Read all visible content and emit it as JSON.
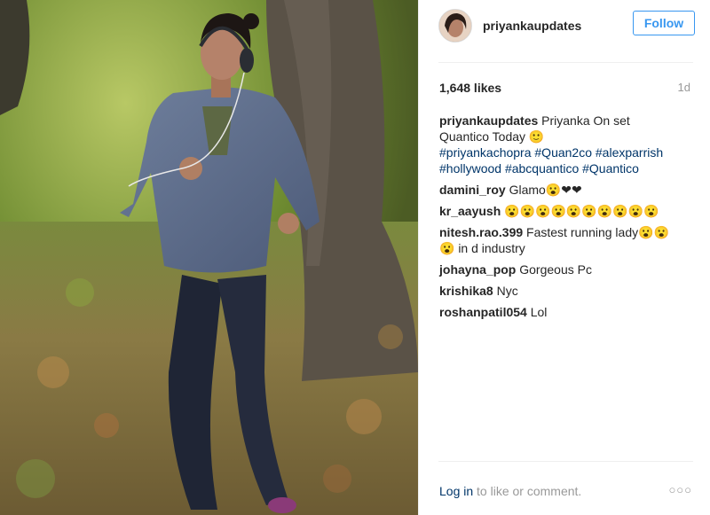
{
  "post": {
    "username": "priyankaupdates",
    "follow_label": "Follow",
    "likes": "1,648 likes",
    "time": "1d",
    "caption": {
      "user": "priyankaupdates",
      "text": "Priyanka On set Quantico Today 🙂",
      "hashtags": "#priyankachopra #Quan2co #alexparrish #hollywood #abcquantico #Quantico"
    },
    "comments": [
      {
        "user": "damini_roy",
        "text": "Glamo😮❤❤"
      },
      {
        "user": "kr_aayush",
        "text": "😮😮😮😮😮😮😮😮😮😮"
      },
      {
        "user": "nitesh.rao.399",
        "text": "Fastest running lady😮😮😮 in d industry"
      },
      {
        "user": "johayna_pop",
        "text": "Gorgeous Pc"
      },
      {
        "user": "krishika8",
        "text": "Nyc"
      },
      {
        "user": "roshanpatil054",
        "text": "Lol"
      }
    ],
    "login_link": "Log in",
    "login_suffix": " to like or comment.",
    "more_label": "○○○"
  },
  "icons": {
    "avatar": "profile-photo",
    "more": "ellipsis-icon"
  }
}
